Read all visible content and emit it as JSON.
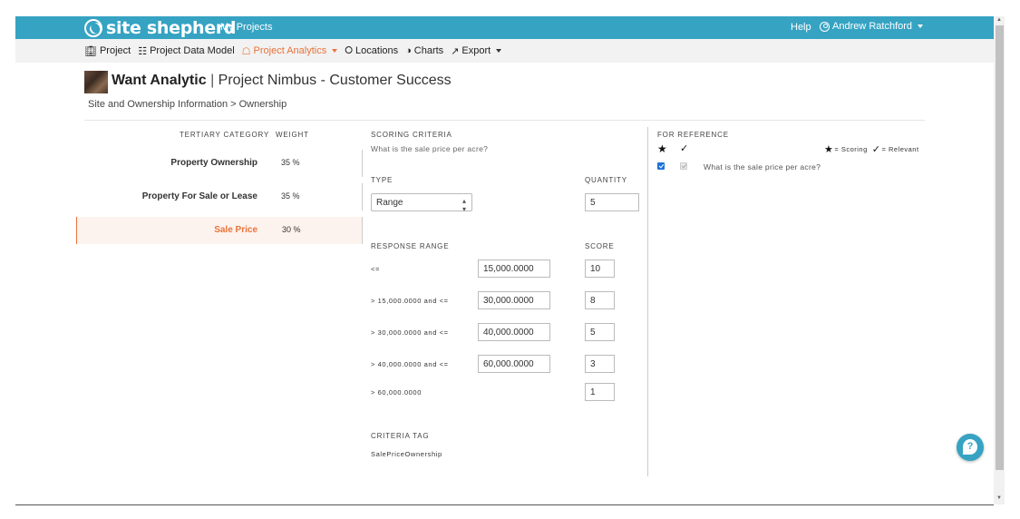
{
  "brand": {
    "name": "site shepherd"
  },
  "topbar": {
    "my_projects": "My Projects",
    "help": "Help",
    "user": "Andrew Ratchford"
  },
  "nav": [
    {
      "label": "Project",
      "icon": "building-icon"
    },
    {
      "label": "Project Data Model",
      "icon": "hierarchy-icon"
    },
    {
      "label": "Project Analytics",
      "icon": "analytics-icon",
      "active": true
    },
    {
      "label": "Locations",
      "icon": "map-pin-icon"
    },
    {
      "label": "Charts",
      "icon": "pie-chart-icon"
    },
    {
      "label": "Export",
      "icon": "export-icon"
    }
  ],
  "header": {
    "org": "Want Analytic",
    "separator": "|",
    "project": "Project Nimbus - Customer Success",
    "breadcrumb": "Site and Ownership Information > Ownership"
  },
  "tertiary": {
    "col_category": "TERTIARY CATEGORY",
    "col_weight": "WEIGHT",
    "rows": [
      {
        "category": "Property Ownership",
        "weight": "35 %"
      },
      {
        "category": "Property For Sale or Lease",
        "weight": "35 %"
      },
      {
        "category": "Sale Price",
        "weight": "30 %",
        "active": true
      }
    ]
  },
  "scoring": {
    "title": "SCORING CRITERIA",
    "question": "What is the sale price per acre?",
    "type_label": "TYPE",
    "type_value": "Range",
    "quantity_label": "QUANTITY",
    "quantity_value": "5",
    "response_range_label": "RESPONSE RANGE",
    "score_label": "SCORE",
    "ranges": [
      {
        "label": "<=",
        "value": "15,000.0000",
        "score": "10"
      },
      {
        "label": "> 15,000.0000 and <=",
        "value": "30,000.0000",
        "score": "8"
      },
      {
        "label": "> 30,000.0000 and <=",
        "value": "40,000.0000",
        "score": "5"
      },
      {
        "label": "> 40,000.0000 and <=",
        "value": "60,000.0000",
        "score": "3"
      },
      {
        "label": "> 60,000.0000",
        "score": "1"
      }
    ],
    "criteria_tag_label": "CRITERIA TAG",
    "criteria_tag_value": "SalePriceOwnership"
  },
  "reference": {
    "title": "FOR REFERENCE",
    "legend_scoring": "= Scoring",
    "legend_relevant": "= Relevant",
    "items": [
      {
        "question": "What is the sale price per acre?",
        "scoring": true,
        "relevant": true
      }
    ]
  },
  "colors": {
    "brand": "#36a3c3",
    "accent": "#e8733a"
  }
}
